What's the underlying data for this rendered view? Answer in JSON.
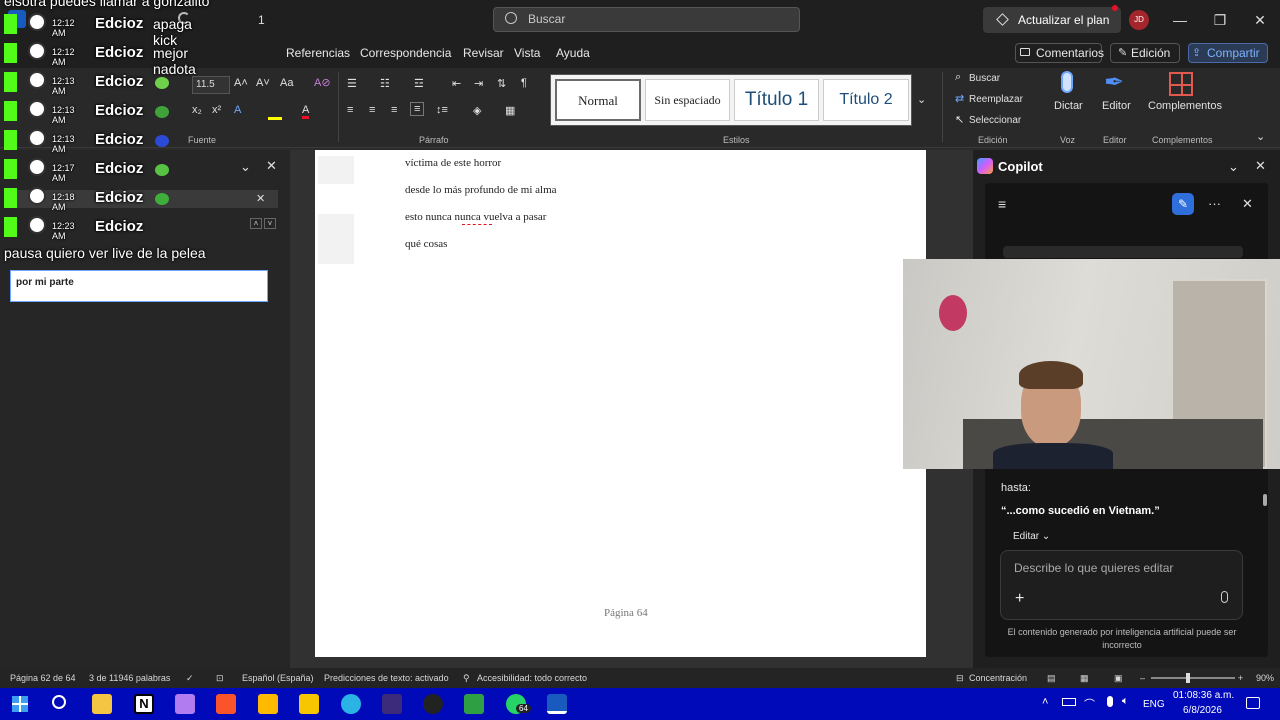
{
  "titlebar": {
    "search_placeholder": "Buscar",
    "upgrade_label": "Actualizar el plan",
    "avatar_initials": "JD",
    "quick_count": "1"
  },
  "menubar": {
    "items": [
      "Referencias",
      "Correspondencia",
      "Revisar",
      "Vista",
      "Ayuda"
    ],
    "comments_label": "Comentarios",
    "edit_label": "Edición",
    "share_label": "Compartir"
  },
  "ribbon": {
    "font_size": "11.5",
    "groups": {
      "font": "Fuente",
      "paragraph": "Párrafo",
      "styles": "Estilos",
      "editing": "Edición",
      "voice": "Voz",
      "editor": "Editor",
      "addins": "Complementos"
    },
    "styles": [
      "Normal",
      "Sin espaciado",
      "Título 1",
      "Título 2"
    ],
    "find_label": "Buscar",
    "replace_label": "Reemplazar",
    "select_label": "Seleccionar",
    "dictate_label": "Dictar",
    "editor_label": "Editor",
    "addins_label": "Complementos"
  },
  "navpane": {
    "search_value": "por mi parte"
  },
  "document": {
    "lines": [
      "víctima de este horror",
      "desde lo más profundo de mi alma",
      "esto nunca nunca vuelva a pasar",
      "qué cosas"
    ],
    "page_footer": "Página 64"
  },
  "copilot": {
    "title": "Copilot",
    "response_intro": "hasta:",
    "response_quote": "“...como sucedió en Vietnam.”",
    "edit_label": "Editar",
    "input_placeholder": "Describe lo que quieres editar",
    "disclaimer": "El contenido generado por inteligencia artificial puede ser incorrecto"
  },
  "statusbar": {
    "page": "Página 62 de 64",
    "words": "3 de 11946 palabras",
    "language": "Español (España)",
    "predictions": "Predicciones de texto: activado",
    "accessibility": "Accesibilidad: todo correcto",
    "focus": "Concentración",
    "zoom": "90%"
  },
  "taskbar": {
    "lang": "ENG",
    "time": "01:08:36 a.m.",
    "date": "6/8/2026",
    "whatsapp_badge": "64"
  },
  "chat_overlay": {
    "top_message": "elsotra puedes llamar a gonzalito",
    "messages": [
      {
        "time": "12:12 AM",
        "user": "Edcioz",
        "text": "apaga kick"
      },
      {
        "time": "12:12 AM",
        "user": "Edcioz",
        "text": "mejor nadota"
      },
      {
        "time": "12:13 AM",
        "user": "Edcioz",
        "text": ""
      },
      {
        "time": "12:13 AM",
        "user": "Edcioz",
        "text": ""
      },
      {
        "time": "12:13 AM",
        "user": "Edcioz",
        "text": ""
      },
      {
        "time": "12:17 AM",
        "user": "Edcioz",
        "text": ""
      },
      {
        "time": "12:18 AM",
        "user": "Edcioz",
        "text": ""
      },
      {
        "time": "12:23 AM",
        "user": "Edcioz",
        "text": ""
      }
    ],
    "last_message": "pausa quiero ver live de la pelea"
  },
  "colors": {
    "word_blue": "#185abd",
    "kick_green": "#53fc18",
    "taskbar": "#000ab8"
  }
}
